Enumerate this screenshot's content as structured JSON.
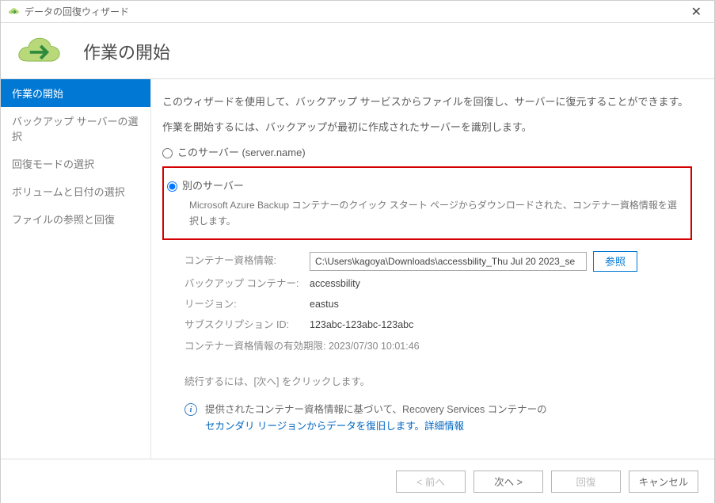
{
  "window": {
    "title": "データの回復ウィザード"
  },
  "header": {
    "title": "作業の開始"
  },
  "sidebar": {
    "steps": [
      "作業の開始",
      "バックアップ サーバーの選択",
      "回復モードの選択",
      "ボリュームと日付の選択",
      "ファイルの参照と回復"
    ]
  },
  "main": {
    "intro1": "このウィザードを使用して、バックアップ サービスからファイルを回復し、サーバーに復元することができます。",
    "intro2": "作業を開始するには、バックアップが最初に作成されたサーバーを識別します。",
    "option1": "このサーバー (server.name)",
    "option2": "別のサーバー",
    "option2_desc": "Microsoft Azure Backup コンテナーのクイック スタート ページからダウンロードされた、コンテナー資格情報を選択します。",
    "cred_label": "コンテナー資格情報:",
    "cred_value": "C:\\Users\\kagoya\\Downloads\\accessbility_Thu Jul 20 2023_se",
    "browse": "参照",
    "container_label": "バックアップ コンテナー:",
    "container_value": "accessbility",
    "region_label": "リージョン:",
    "region_value": "eastus",
    "sub_label": "サブスクリプション ID:",
    "sub_value": "123abc-123abc-123abc",
    "expiry": "コンテナー資格情報の有効期限: 2023/07/30 10:01:46",
    "continue_hint": "続行するには、[次へ] をクリックします。",
    "info_text1": "提供されたコンテナー資格情報に基づいて、Recovery Services コンテナーの",
    "info_link": "セカンダリ リージョンからデータを復旧します。詳細情報"
  },
  "footer": {
    "prev": "< 前へ",
    "next": "次へ >",
    "recover": "回復",
    "cancel": "キャンセル"
  }
}
